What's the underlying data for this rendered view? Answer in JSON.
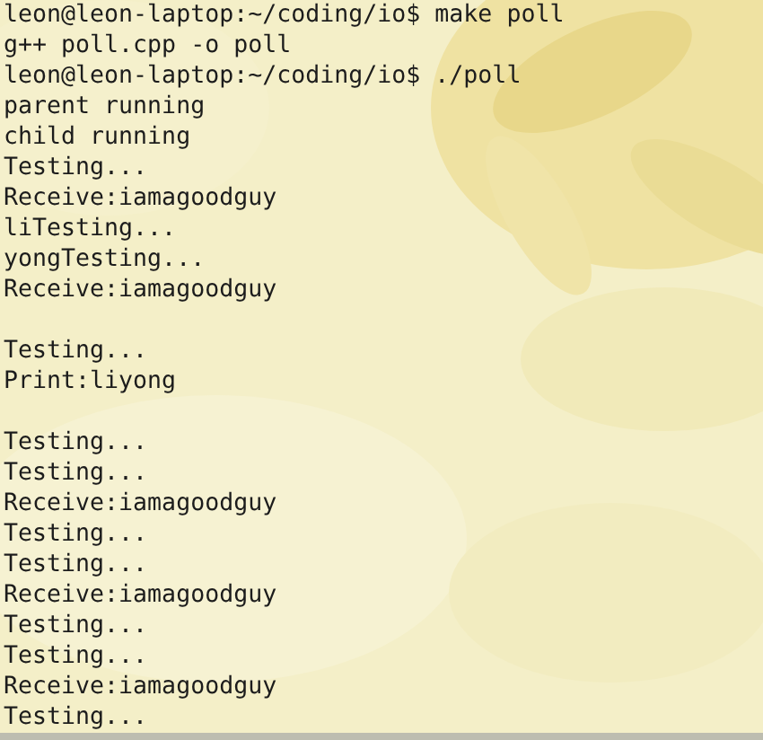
{
  "terminal": {
    "background": {
      "kind": "picture"
    },
    "blocks": [
      [
        "leon@leon-laptop:~/coding/io$ make poll",
        "g++ poll.cpp -o poll",
        "leon@leon-laptop:~/coding/io$ ./poll",
        "parent running",
        "child running",
        "Testing...",
        "Receive:iamagoodguy",
        "liTesting...",
        "yongTesting...",
        "Receive:iamagoodguy"
      ],
      [
        "Testing...",
        "Print:liyong"
      ],
      [
        "Testing...",
        "Testing...",
        "Receive:iamagoodguy",
        "Testing...",
        "Testing...",
        "Receive:iamagoodguy",
        "Testing...",
        "Testing...",
        "Receive:iamagoodguy",
        "Testing..."
      ]
    ]
  }
}
